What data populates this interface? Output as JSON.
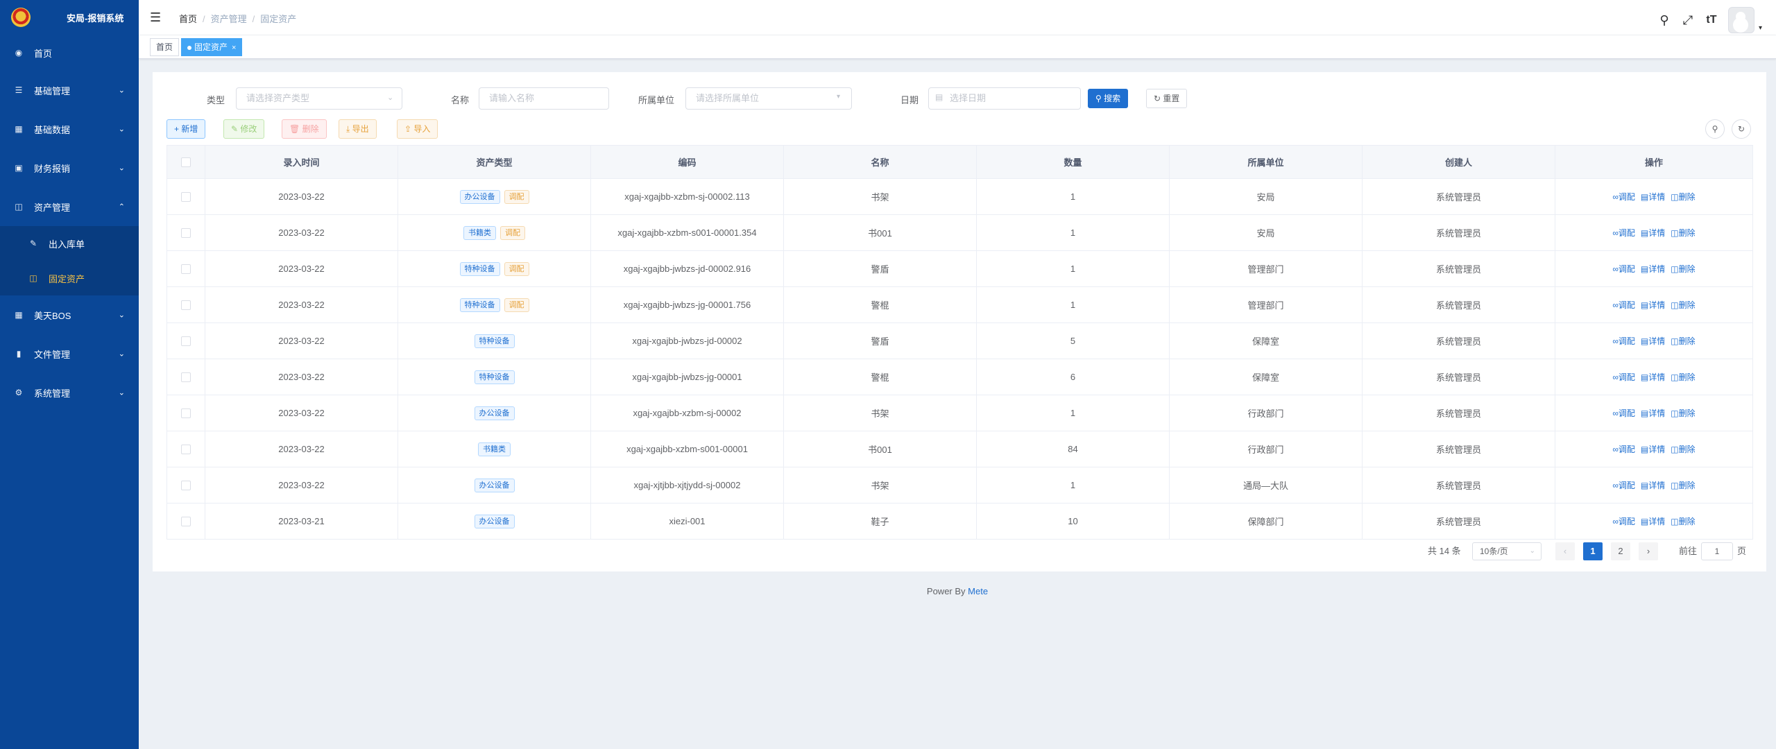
{
  "app": {
    "title": "安局-报销系统"
  },
  "sidebar": {
    "items": [
      {
        "label": "首页",
        "icon": "dashboard-icon"
      },
      {
        "label": "基础管理",
        "icon": "sitemap-icon"
      },
      {
        "label": "基础数据",
        "icon": "id-card-icon"
      },
      {
        "label": "财务报销",
        "icon": "money-icon"
      },
      {
        "label": "资产管理",
        "icon": "database-icon"
      },
      {
        "label": "美天BOS",
        "icon": "grid-icon"
      },
      {
        "label": "文件管理",
        "icon": "file-icon"
      },
      {
        "label": "系统管理",
        "icon": "gear-icon"
      }
    ],
    "sub_items": [
      {
        "label": "出入库单",
        "icon": "edit-icon"
      },
      {
        "label": "固定资产",
        "icon": "database-icon"
      }
    ]
  },
  "header": {
    "breadcrumb": [
      "首页",
      "资产管理",
      "固定资产"
    ]
  },
  "tags": {
    "home": "首页",
    "active": "固定资产"
  },
  "filters": {
    "type_label": "类型",
    "type_placeholder": "请选择资产类型",
    "name_label": "名称",
    "name_placeholder": "请输入名称",
    "unit_label": "所属单位",
    "unit_placeholder": "请选择所属单位",
    "date_label": "日期",
    "date_placeholder": "选择日期",
    "search_button": "搜索",
    "reset_button": "重置"
  },
  "toolbar": {
    "add": "新增",
    "edit": "修改",
    "delete": "删除",
    "export": "导出",
    "import": "导入"
  },
  "table": {
    "columns": [
      "录入时间",
      "资产类型",
      "编码",
      "名称",
      "数量",
      "所属单位",
      "创建人",
      "操作"
    ],
    "actions": [
      "调配",
      "详情",
      "删除"
    ],
    "rows": [
      {
        "date": "2023-03-22",
        "type": "办公设备",
        "tag": "调配",
        "code": "xgaj-xgajbb-xzbm-sj-00002.113",
        "name": "书架",
        "qty": "1",
        "unit": "安局",
        "creator": "系统管理员"
      },
      {
        "date": "2023-03-22",
        "type": "书籍类",
        "tag": "调配",
        "code": "xgaj-xgajbb-xzbm-s001-00001.354",
        "name": "书001",
        "qty": "1",
        "unit": "安局",
        "creator": "系统管理员"
      },
      {
        "date": "2023-03-22",
        "type": "特种设备",
        "tag": "调配",
        "code": "xgaj-xgajbb-jwbzs-jd-00002.916",
        "name": "警盾",
        "qty": "1",
        "unit": "管理部门",
        "creator": "系统管理员"
      },
      {
        "date": "2023-03-22",
        "type": "特种设备",
        "tag": "调配",
        "code": "xgaj-xgajbb-jwbzs-jg-00001.756",
        "name": "警棍",
        "qty": "1",
        "unit": "管理部门",
        "creator": "系统管理员"
      },
      {
        "date": "2023-03-22",
        "type": "特种设备",
        "tag": "",
        "code": "xgaj-xgajbb-jwbzs-jd-00002",
        "name": "警盾",
        "qty": "5",
        "unit": "保障室",
        "creator": "系统管理员"
      },
      {
        "date": "2023-03-22",
        "type": "特种设备",
        "tag": "",
        "code": "xgaj-xgajbb-jwbzs-jg-00001",
        "name": "警棍",
        "qty": "6",
        "unit": "保障室",
        "creator": "系统管理员"
      },
      {
        "date": "2023-03-22",
        "type": "办公设备",
        "tag": "",
        "code": "xgaj-xgajbb-xzbm-sj-00002",
        "name": "书架",
        "qty": "1",
        "unit": "行政部门",
        "creator": "系统管理员"
      },
      {
        "date": "2023-03-22",
        "type": "书籍类",
        "tag": "",
        "code": "xgaj-xgajbb-xzbm-s001-00001",
        "name": "书001",
        "qty": "84",
        "unit": "行政部门",
        "creator": "系统管理员"
      },
      {
        "date": "2023-03-22",
        "type": "办公设备",
        "tag": "",
        "code": "xgaj-xjtjbb-xjtjydd-sj-00002",
        "name": "书架",
        "qty": "1",
        "unit": "通局—大队",
        "creator": "系统管理员"
      },
      {
        "date": "2023-03-21",
        "type": "办公设备",
        "tag": "",
        "code": "xiezi-001",
        "name": "鞋子",
        "qty": "10",
        "unit": "保障部门",
        "creator": "系统管理员"
      }
    ]
  },
  "pagination": {
    "total_text": "共 14 条",
    "page_size": "10条/页",
    "pages": [
      "1",
      "2"
    ],
    "goto_prefix": "前往",
    "goto_value": "1",
    "goto_suffix": "页"
  },
  "footer": {
    "prefix": "Power By",
    "link": "Mete"
  }
}
